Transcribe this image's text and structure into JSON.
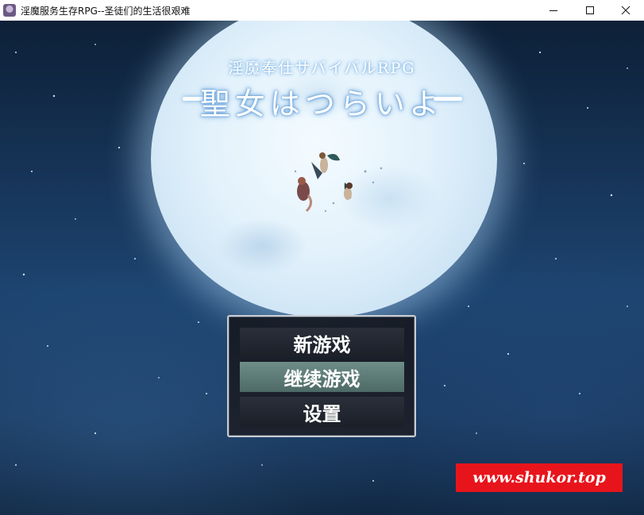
{
  "window": {
    "title": "淫魔服务生存RPG--圣徒们的生活很艰难",
    "icons": [
      "app-icon",
      "minimize-icon",
      "maximize-icon",
      "close-icon"
    ]
  },
  "game": {
    "subtitle": "淫魔奉仕サバイバルRPG",
    "title": "聖女はつらいよ",
    "menu": [
      {
        "label": "新游戏",
        "selected": false
      },
      {
        "label": "继续游戏",
        "selected": true
      },
      {
        "label": "设置",
        "selected": false
      }
    ],
    "watermark": "www.shukor.top",
    "colors": {
      "selected_item": "#5e7c78",
      "watermark_bg": "#e8141c",
      "sky": "#1d4470",
      "moon": "#e2f1fb"
    }
  }
}
